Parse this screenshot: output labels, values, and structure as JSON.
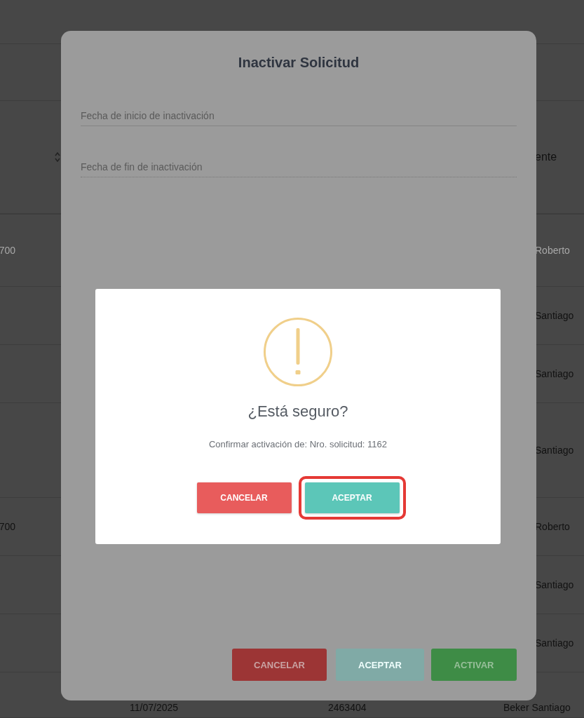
{
  "background_table": {
    "header": {
      "column_right": "ente"
    },
    "rows": [
      {
        "kind": "partial",
        "inactive": true,
        "cells": [
          "700",
          "Roberto"
        ]
      },
      {
        "kind": "partial",
        "inactive": false,
        "cells": [
          "",
          "Santiago"
        ]
      },
      {
        "kind": "partial",
        "inactive": false,
        "cells": [
          "",
          "Santiago"
        ]
      },
      {
        "kind": "partial",
        "inactive": false,
        "cells": [
          "",
          "Santiago"
        ]
      },
      {
        "kind": "partial",
        "inactive": false,
        "cells": [
          "700",
          "Roberto"
        ]
      },
      {
        "kind": "partial",
        "inactive": false,
        "cells": [
          "",
          "Santiago"
        ]
      },
      {
        "kind": "partial",
        "inactive": false,
        "cells": [
          "",
          "Santiago"
        ]
      },
      {
        "kind": "full",
        "inactive": false,
        "cells": [
          "11/07/2025",
          "2463404",
          "Beker Santiago"
        ]
      }
    ]
  },
  "modal": {
    "title": "Inactivar Solicitud",
    "fields": [
      {
        "placeholder": "Fecha de inicio de inactivación",
        "disabled": false
      },
      {
        "placeholder": "Fecha de fin de inactivación",
        "disabled": true
      }
    ],
    "buttons": [
      {
        "label": "CANCELAR",
        "kind": "danger",
        "disabled": false
      },
      {
        "label": "ACEPTAR",
        "kind": "primary",
        "disabled": true
      },
      {
        "label": "ACTIVAR",
        "kind": "success",
        "disabled": false
      }
    ]
  },
  "alert": {
    "title": "¿Está seguro?",
    "text": "Confirmar activación de: Nro. solicitud: 1162",
    "buttons": [
      {
        "label": "CANCELAR",
        "kind": "danger",
        "highlighted": false
      },
      {
        "label": "ACEPTAR",
        "kind": "primary",
        "highlighted": true
      }
    ]
  }
}
